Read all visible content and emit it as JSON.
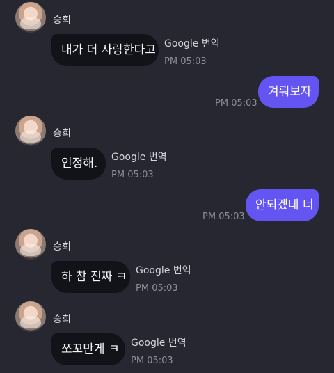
{
  "messages": [
    {
      "sender": "승희",
      "text": "내가 더 사랑한다고",
      "translate_label": "Google 번역",
      "time": "PM 05:03"
    },
    {
      "text": "겨뤄보자",
      "time": "PM 05:03"
    },
    {
      "sender": "승희",
      "text": "인정해.",
      "translate_label": "Google 번역",
      "time": "PM 05:03"
    },
    {
      "text": "안되겠네 너",
      "time": "PM 05:03"
    },
    {
      "sender": "승희",
      "text": "하 참 진짜 ㅋ",
      "translate_label": "Google 번역",
      "time": "PM 05:03"
    },
    {
      "sender": "승희",
      "text": "쪼꼬만게 ㅋ",
      "translate_label": "Google 번역",
      "time": "PM 05:03"
    }
  ]
}
